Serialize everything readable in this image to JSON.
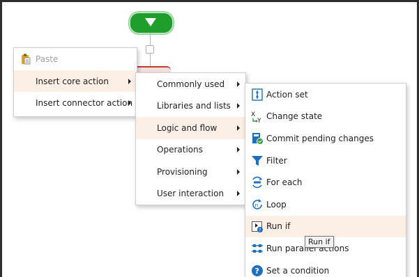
{
  "context_menu": {
    "items": [
      {
        "label": "Paste",
        "disabled": true,
        "icon": "paste-icon"
      },
      {
        "label": "Insert core action",
        "submenu": true
      },
      {
        "label": "Insert connector action",
        "submenu": true
      }
    ]
  },
  "core_action_menu": {
    "items": [
      {
        "label": "Commonly used"
      },
      {
        "label": "Libraries and lists"
      },
      {
        "label": "Logic and flow"
      },
      {
        "label": "Operations"
      },
      {
        "label": "Provisioning"
      },
      {
        "label": "User interaction"
      }
    ]
  },
  "logic_flow_menu": {
    "items": [
      {
        "label": "Action set",
        "icon": "action-set-icon"
      },
      {
        "label": "Change state",
        "icon": "change-state-icon"
      },
      {
        "label": "Commit pending changes",
        "icon": "commit-icon"
      },
      {
        "label": "Filter",
        "icon": "filter-icon"
      },
      {
        "label": "For each",
        "icon": "for-each-icon"
      },
      {
        "label": "Loop",
        "icon": "loop-icon"
      },
      {
        "label": "Run if",
        "icon": "run-if-icon"
      },
      {
        "label": "Run parallel actions",
        "icon": "run-parallel-icon"
      },
      {
        "label": "Set a condition",
        "icon": "set-condition-icon"
      }
    ]
  },
  "tooltip": {
    "text": "Run if"
  },
  "colors": {
    "start_node": "#1f9e2c",
    "highlight": "#fcefe6",
    "icon_blue": "#1f6fbf"
  }
}
